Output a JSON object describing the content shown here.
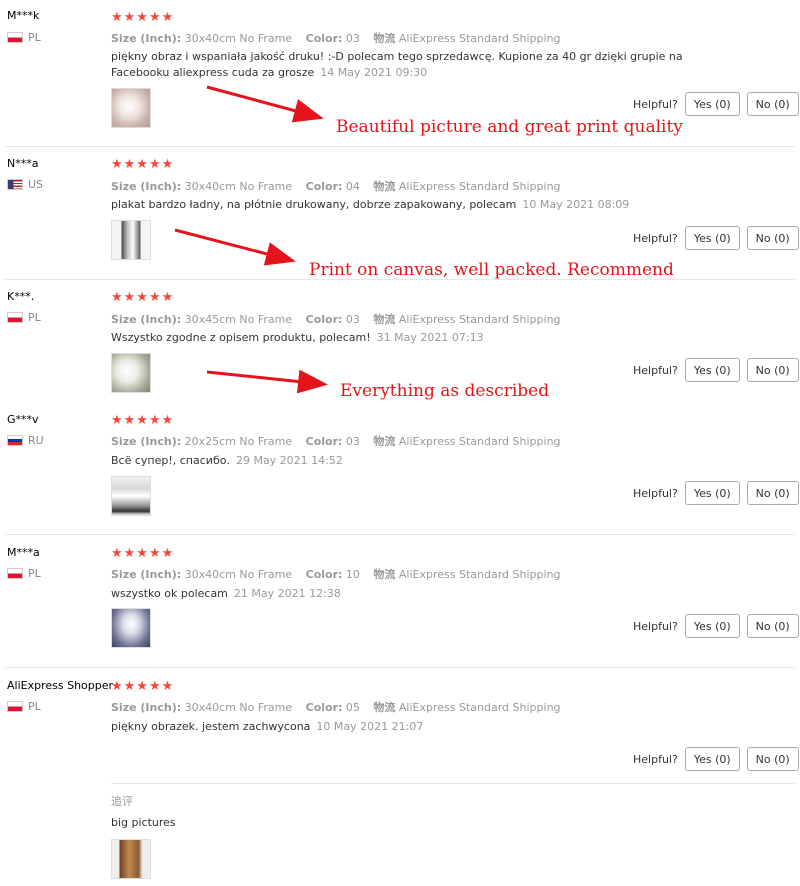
{
  "labels": {
    "size_key": "Size (Inch):",
    "color_key": "Color:",
    "shipping_key": "物流",
    "helpful": "Helpful?"
  },
  "accent_color": "#f4483d",
  "annotation_color": "#e3141b",
  "reviews": [
    {
      "user": "M***k",
      "country": "PL",
      "flag": "pl",
      "rating": 5,
      "stars": "★★★★★",
      "size": "30x40cm No Frame",
      "color": "03",
      "shipping": "AliExpress Standard Shipping",
      "text": "piękny obraz i wspaniała jakość druku! :-D polecam tego sprzedawcę. Kupione za 40 gr dzięki grupie na Facebooku aliexpress cuda za grosze",
      "date": "14 May 2021 09:30",
      "yes": "Yes (0)",
      "no": "No (0)",
      "annotation": "Beautiful picture and great print quality"
    },
    {
      "user": "N***a",
      "country": "US",
      "flag": "us",
      "rating": 5,
      "stars": "★★★★★",
      "size": "30x40cm No Frame",
      "color": "04",
      "shipping": "AliExpress Standard Shipping",
      "text": "plakat bardzo ładny, na płótnie drukowany, dobrze zapakowany, polecam",
      "date": "10 May 2021 08:09",
      "yes": "Yes (0)",
      "no": "No (0)",
      "annotation": "Print on canvas, well packed. Recommend"
    },
    {
      "user": "K***.",
      "country": "PL",
      "flag": "pl",
      "rating": 5,
      "stars": "★★★★★",
      "size": "30x45cm No Frame",
      "color": "03",
      "shipping": "AliExpress Standard Shipping",
      "text": "Wszystko zgodne z opisem produktu, polecam!",
      "date": "31 May 2021 07:13",
      "yes": "Yes (0)",
      "no": "No (0)",
      "annotation": "Everything as described"
    },
    {
      "user": "G***v",
      "country": "RU",
      "flag": "ru",
      "rating": 5,
      "stars": "★★★★★",
      "size": "20x25cm No Frame",
      "color": "03",
      "shipping": "AliExpress Standard Shipping",
      "text": "Всё супер!, спасибо.",
      "date": "29 May 2021 14:52",
      "yes": "Yes (0)",
      "no": "No (0)"
    },
    {
      "user": "M***a",
      "country": "PL",
      "flag": "pl",
      "rating": 5,
      "stars": "★★★★★",
      "size": "30x40cm No Frame",
      "color": "10",
      "shipping": "AliExpress Standard Shipping",
      "text": "wszystko ok polecam",
      "date": "21 May 2021 12:38",
      "yes": "Yes (0)",
      "no": "No (0)"
    },
    {
      "user": "AliExpress Shopper",
      "country": "PL",
      "flag": "pl",
      "rating": 5,
      "stars": "★★★★★",
      "size": "30x40cm No Frame",
      "color": "05",
      "shipping": "AliExpress Standard Shipping",
      "text": "piękny obrazek. jestem zachwycona",
      "date": "10 May 2021 21:07",
      "yes": "Yes (0)",
      "no": "No (0)",
      "followup_label": "追评",
      "followup_text": "big pictures"
    }
  ]
}
